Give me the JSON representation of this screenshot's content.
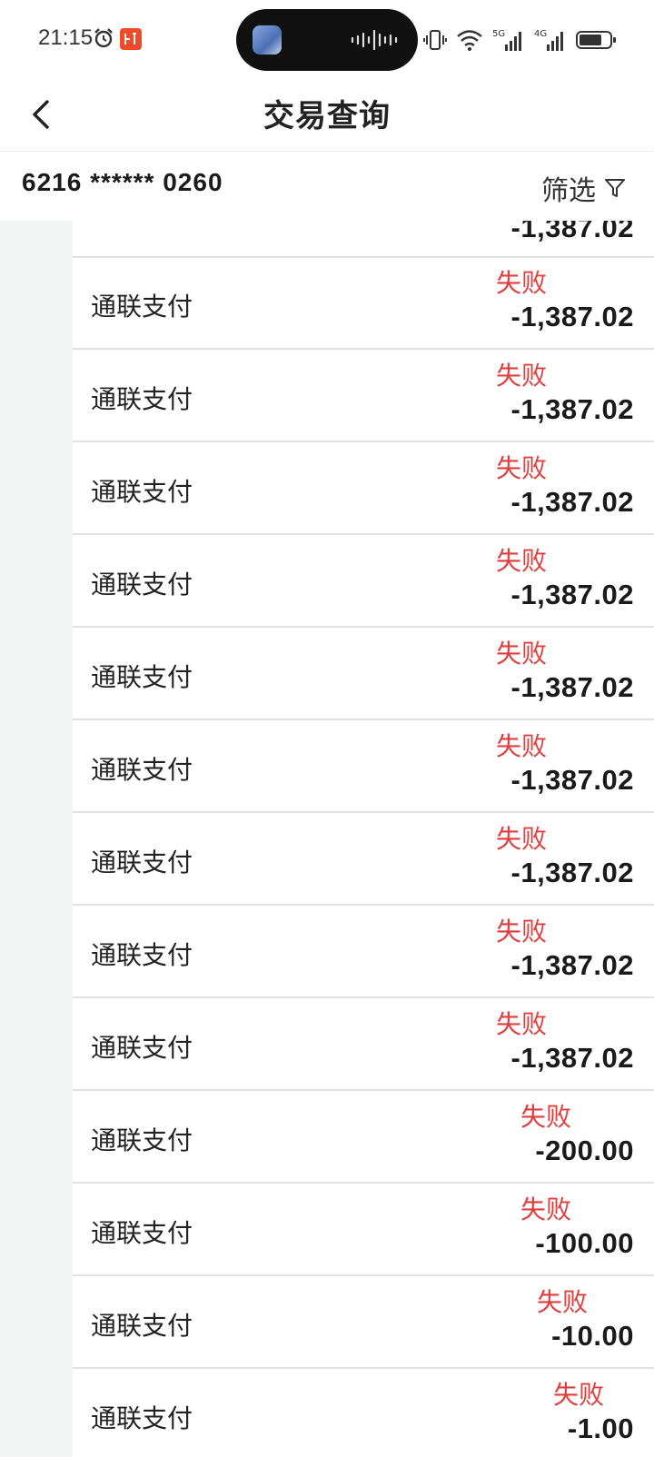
{
  "status_bar": {
    "time": "21:15",
    "icons": [
      "alarm-icon",
      "app-notification-icon",
      "vibrate-icon",
      "wifi-icon",
      "signal-5g-icon",
      "signal-4g-icon",
      "battery-icon"
    ],
    "network_labels": [
      "5G",
      "4G"
    ]
  },
  "header": {
    "title": "交易查询"
  },
  "account": {
    "number": "6216 ****** 0260",
    "filter_label": "筛选"
  },
  "transactions": {
    "partial_amount": "-1,387.02",
    "items": [
      {
        "title": "通联支付",
        "status": "失败",
        "amount": "-1,387.02"
      },
      {
        "title": "通联支付",
        "status": "失败",
        "amount": "-1,387.02"
      },
      {
        "title": "通联支付",
        "status": "失败",
        "amount": "-1,387.02"
      },
      {
        "title": "通联支付",
        "status": "失败",
        "amount": "-1,387.02"
      },
      {
        "title": "通联支付",
        "status": "失败",
        "amount": "-1,387.02"
      },
      {
        "title": "通联支付",
        "status": "失败",
        "amount": "-1,387.02"
      },
      {
        "title": "通联支付",
        "status": "失败",
        "amount": "-1,387.02"
      },
      {
        "title": "通联支付",
        "status": "失败",
        "amount": "-1,387.02"
      },
      {
        "title": "通联支付",
        "status": "失败",
        "amount": "-1,387.02"
      },
      {
        "title": "通联支付",
        "status": "失败",
        "amount": "-200.00"
      },
      {
        "title": "通联支付",
        "status": "失败",
        "amount": "-100.00"
      },
      {
        "title": "通联支付",
        "status": "失败",
        "amount": "-10.00"
      },
      {
        "title": "通联支付",
        "status": "失败",
        "amount": "-1.00"
      }
    ]
  },
  "colors": {
    "status_failed": "#e23d3d",
    "divider": "#e2e2e2",
    "side_strip": "#f3f5f4"
  }
}
